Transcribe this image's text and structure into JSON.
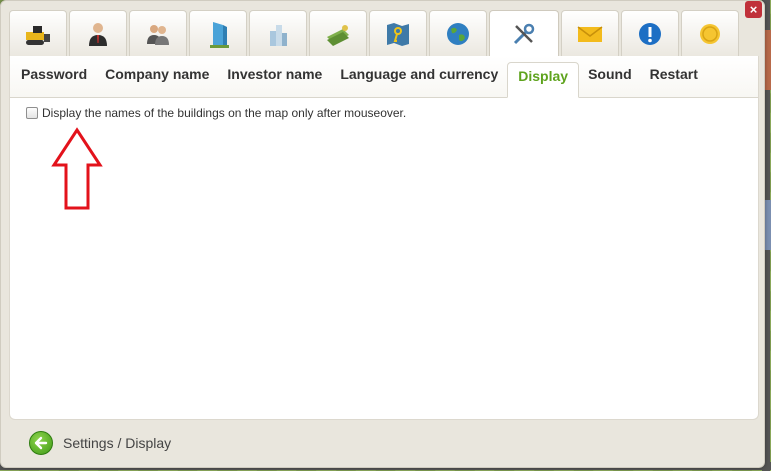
{
  "window": {
    "close_label": "×"
  },
  "icon_tabs": [
    {
      "name": "bulldozer-icon"
    },
    {
      "name": "businessman-icon"
    },
    {
      "name": "users-icon"
    },
    {
      "name": "office-building-icon"
    },
    {
      "name": "city-buildings-icon"
    },
    {
      "name": "money-icon"
    },
    {
      "name": "map-key-icon"
    },
    {
      "name": "globe-icon"
    },
    {
      "name": "tools-settings-icon",
      "active": true
    },
    {
      "name": "mail-icon"
    },
    {
      "name": "info-icon"
    },
    {
      "name": "coin-icon"
    }
  ],
  "subtabs": [
    {
      "label": "Password"
    },
    {
      "label": "Company name"
    },
    {
      "label": "Investor name"
    },
    {
      "label": "Language and currency"
    },
    {
      "label": "Display",
      "active": true
    },
    {
      "label": "Sound"
    },
    {
      "label": "Restart"
    }
  ],
  "display_option": {
    "label": "Display the names of the buildings on the map only after mouseover.",
    "checked": false
  },
  "footer": {
    "breadcrumb": "Settings / Display"
  },
  "colors": {
    "active_subtab": "#5ea31d",
    "annotation_arrow": "#e3121b",
    "close_button": "#c0313a"
  }
}
